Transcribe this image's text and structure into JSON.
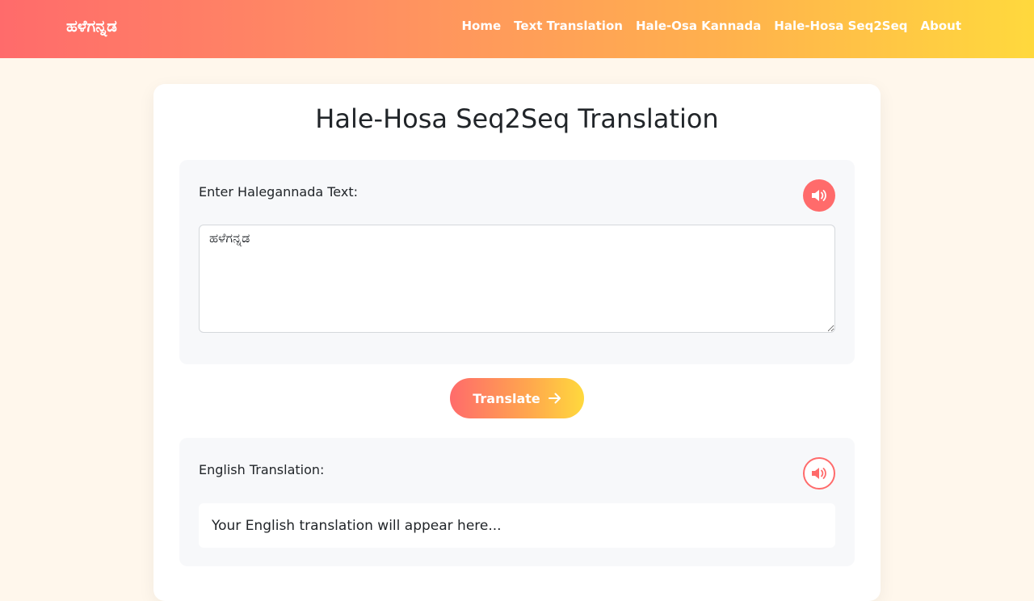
{
  "nav": {
    "brand": "ಹಳೆಗನ್ನಡ",
    "links": [
      "Home",
      "Text Translation",
      "Hale-Osa Kannada",
      "Hale-Hosa Seq2Seq",
      "About"
    ]
  },
  "main": {
    "title": "Hale-Hosa Seq2Seq Translation",
    "input_label": "Enter Halegannada Text:",
    "input_value": "ಹಳೆಗನ್ನಡ",
    "translate_label": "Translate",
    "output_label": "English Translation:",
    "output_placeholder": "Your English translation will appear here..."
  },
  "icons": {
    "speak_input": "volume-icon",
    "speak_output": "volume-icon",
    "translate": "arrow-right-icon"
  },
  "colors": {
    "accent": "#ff6b6b",
    "accent_end": "#ffd93d",
    "background": "#fff7ec"
  }
}
